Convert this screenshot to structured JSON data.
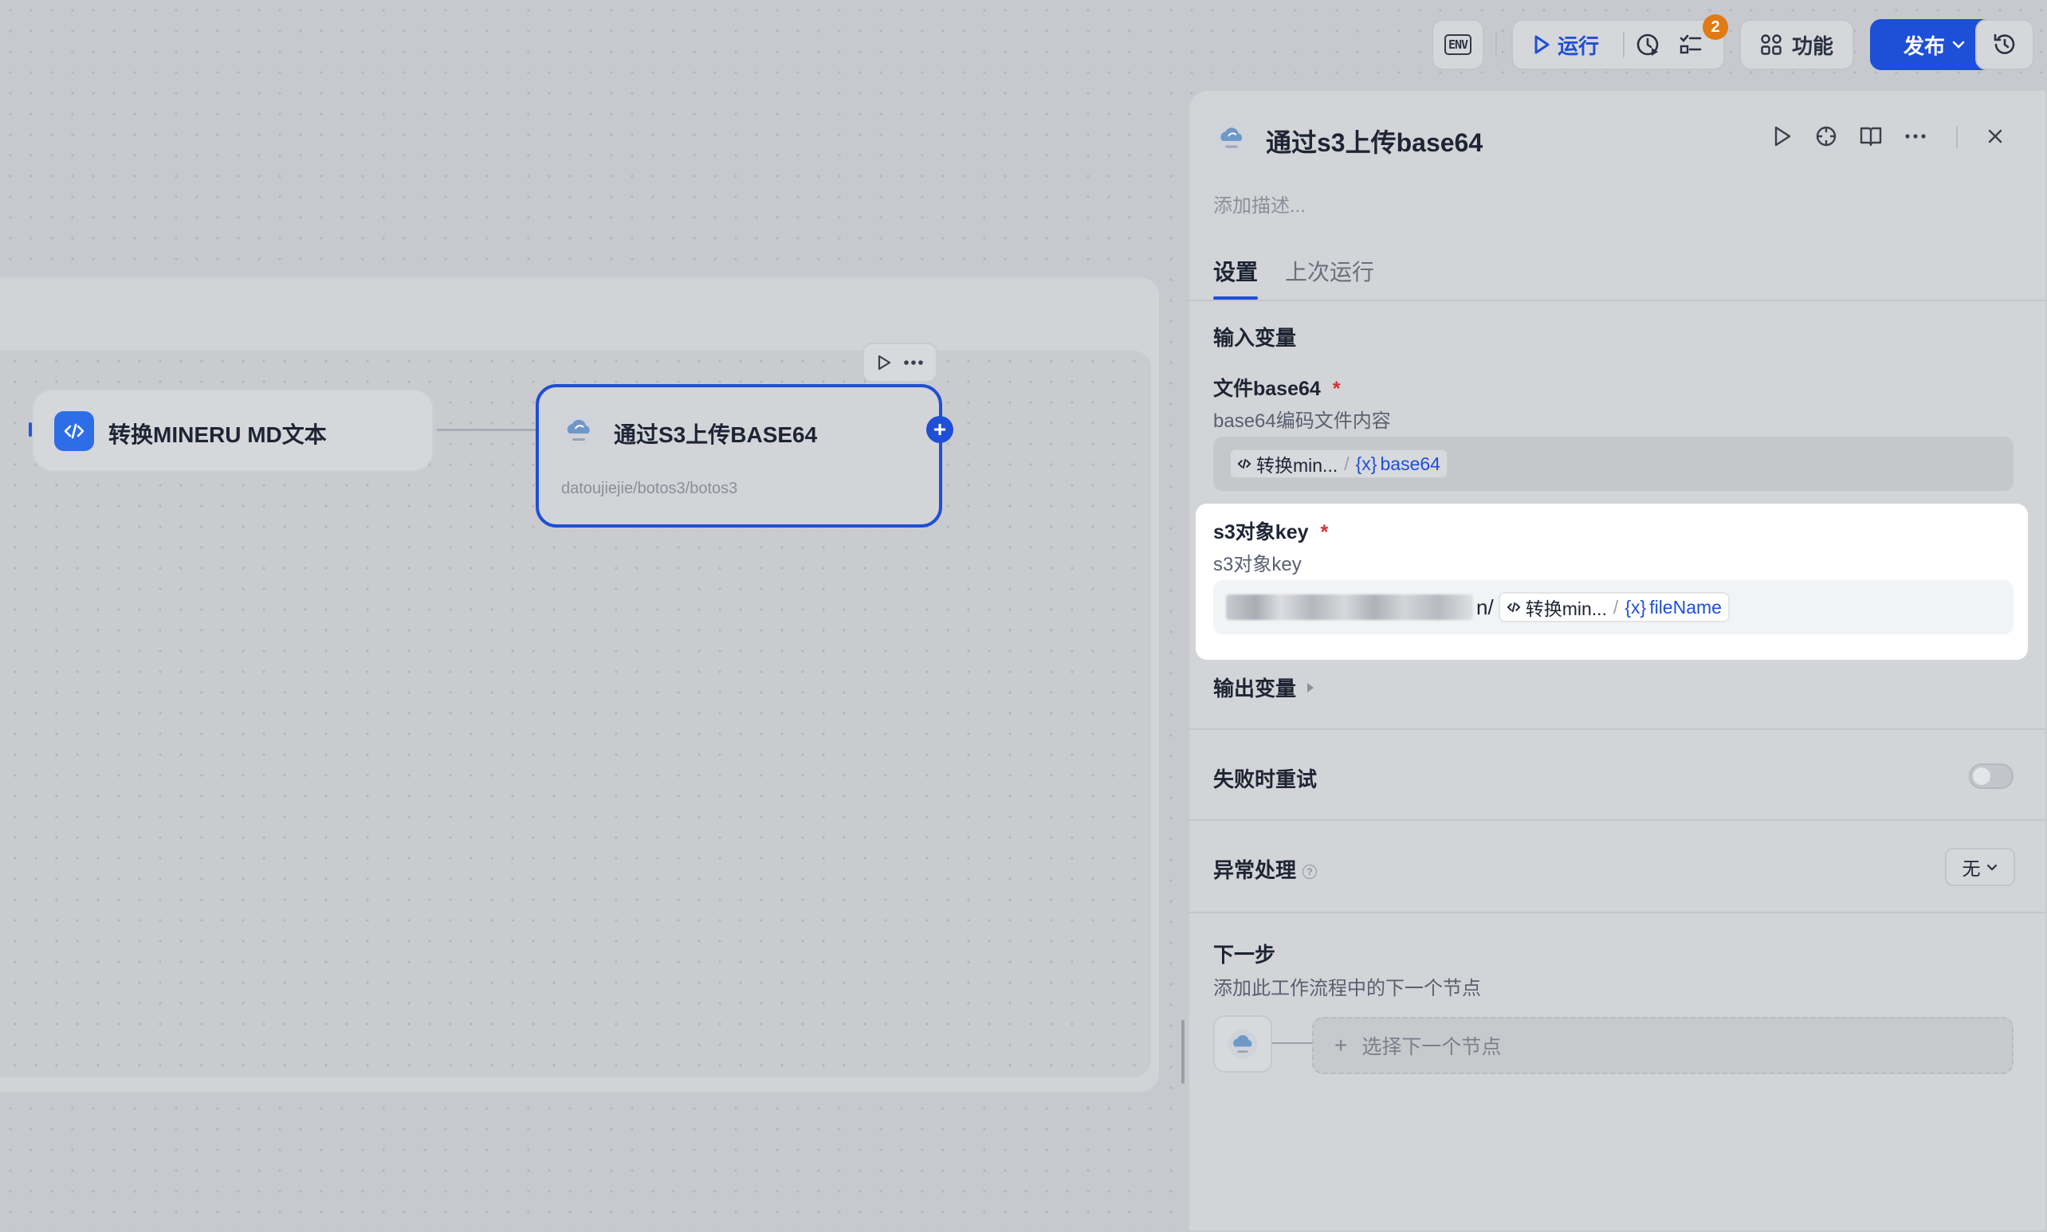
{
  "toolbar": {
    "env_label": "ENV",
    "run_label": "运行",
    "checklist_badge": "2",
    "features_label": "功能",
    "publish_label": "发布"
  },
  "canvas": {
    "node_code": {
      "title": "转换MINERU MD文本",
      "icon": "code-icon"
    },
    "node_s3": {
      "title": "通过S3上传BASE64",
      "subtitle": "datoujiejie/botos3/botos3",
      "icon": "cloud-icon"
    }
  },
  "panel": {
    "title": "通过s3上传base64",
    "description_placeholder": "添加描述...",
    "tabs": [
      {
        "label": "设置",
        "active": true
      },
      {
        "label": "上次运行",
        "active": false
      }
    ],
    "inputs_section": "输入变量",
    "fields": [
      {
        "label": "文件base64",
        "required": "*",
        "description": "base64编码文件内容",
        "value_node": "转换min...",
        "value_var": "base64"
      },
      {
        "label": "s3对象key",
        "required": "*",
        "description": "s3对象key",
        "value_suffix": "n/",
        "value_node": "转换min...",
        "value_var": "fileName"
      }
    ],
    "outputs_section": "输出变量",
    "retry_label": "失败时重试",
    "retry_enabled": false,
    "error_handling_label": "异常处理",
    "error_handling_value": "无",
    "next_step": {
      "title": "下一步",
      "description": "添加此工作流程中的下一个节点",
      "select_label": "选择下一个节点"
    }
  },
  "colors": {
    "accent": "#1f4fd6",
    "badge": "#e07a14",
    "required": "#d92d2d"
  }
}
